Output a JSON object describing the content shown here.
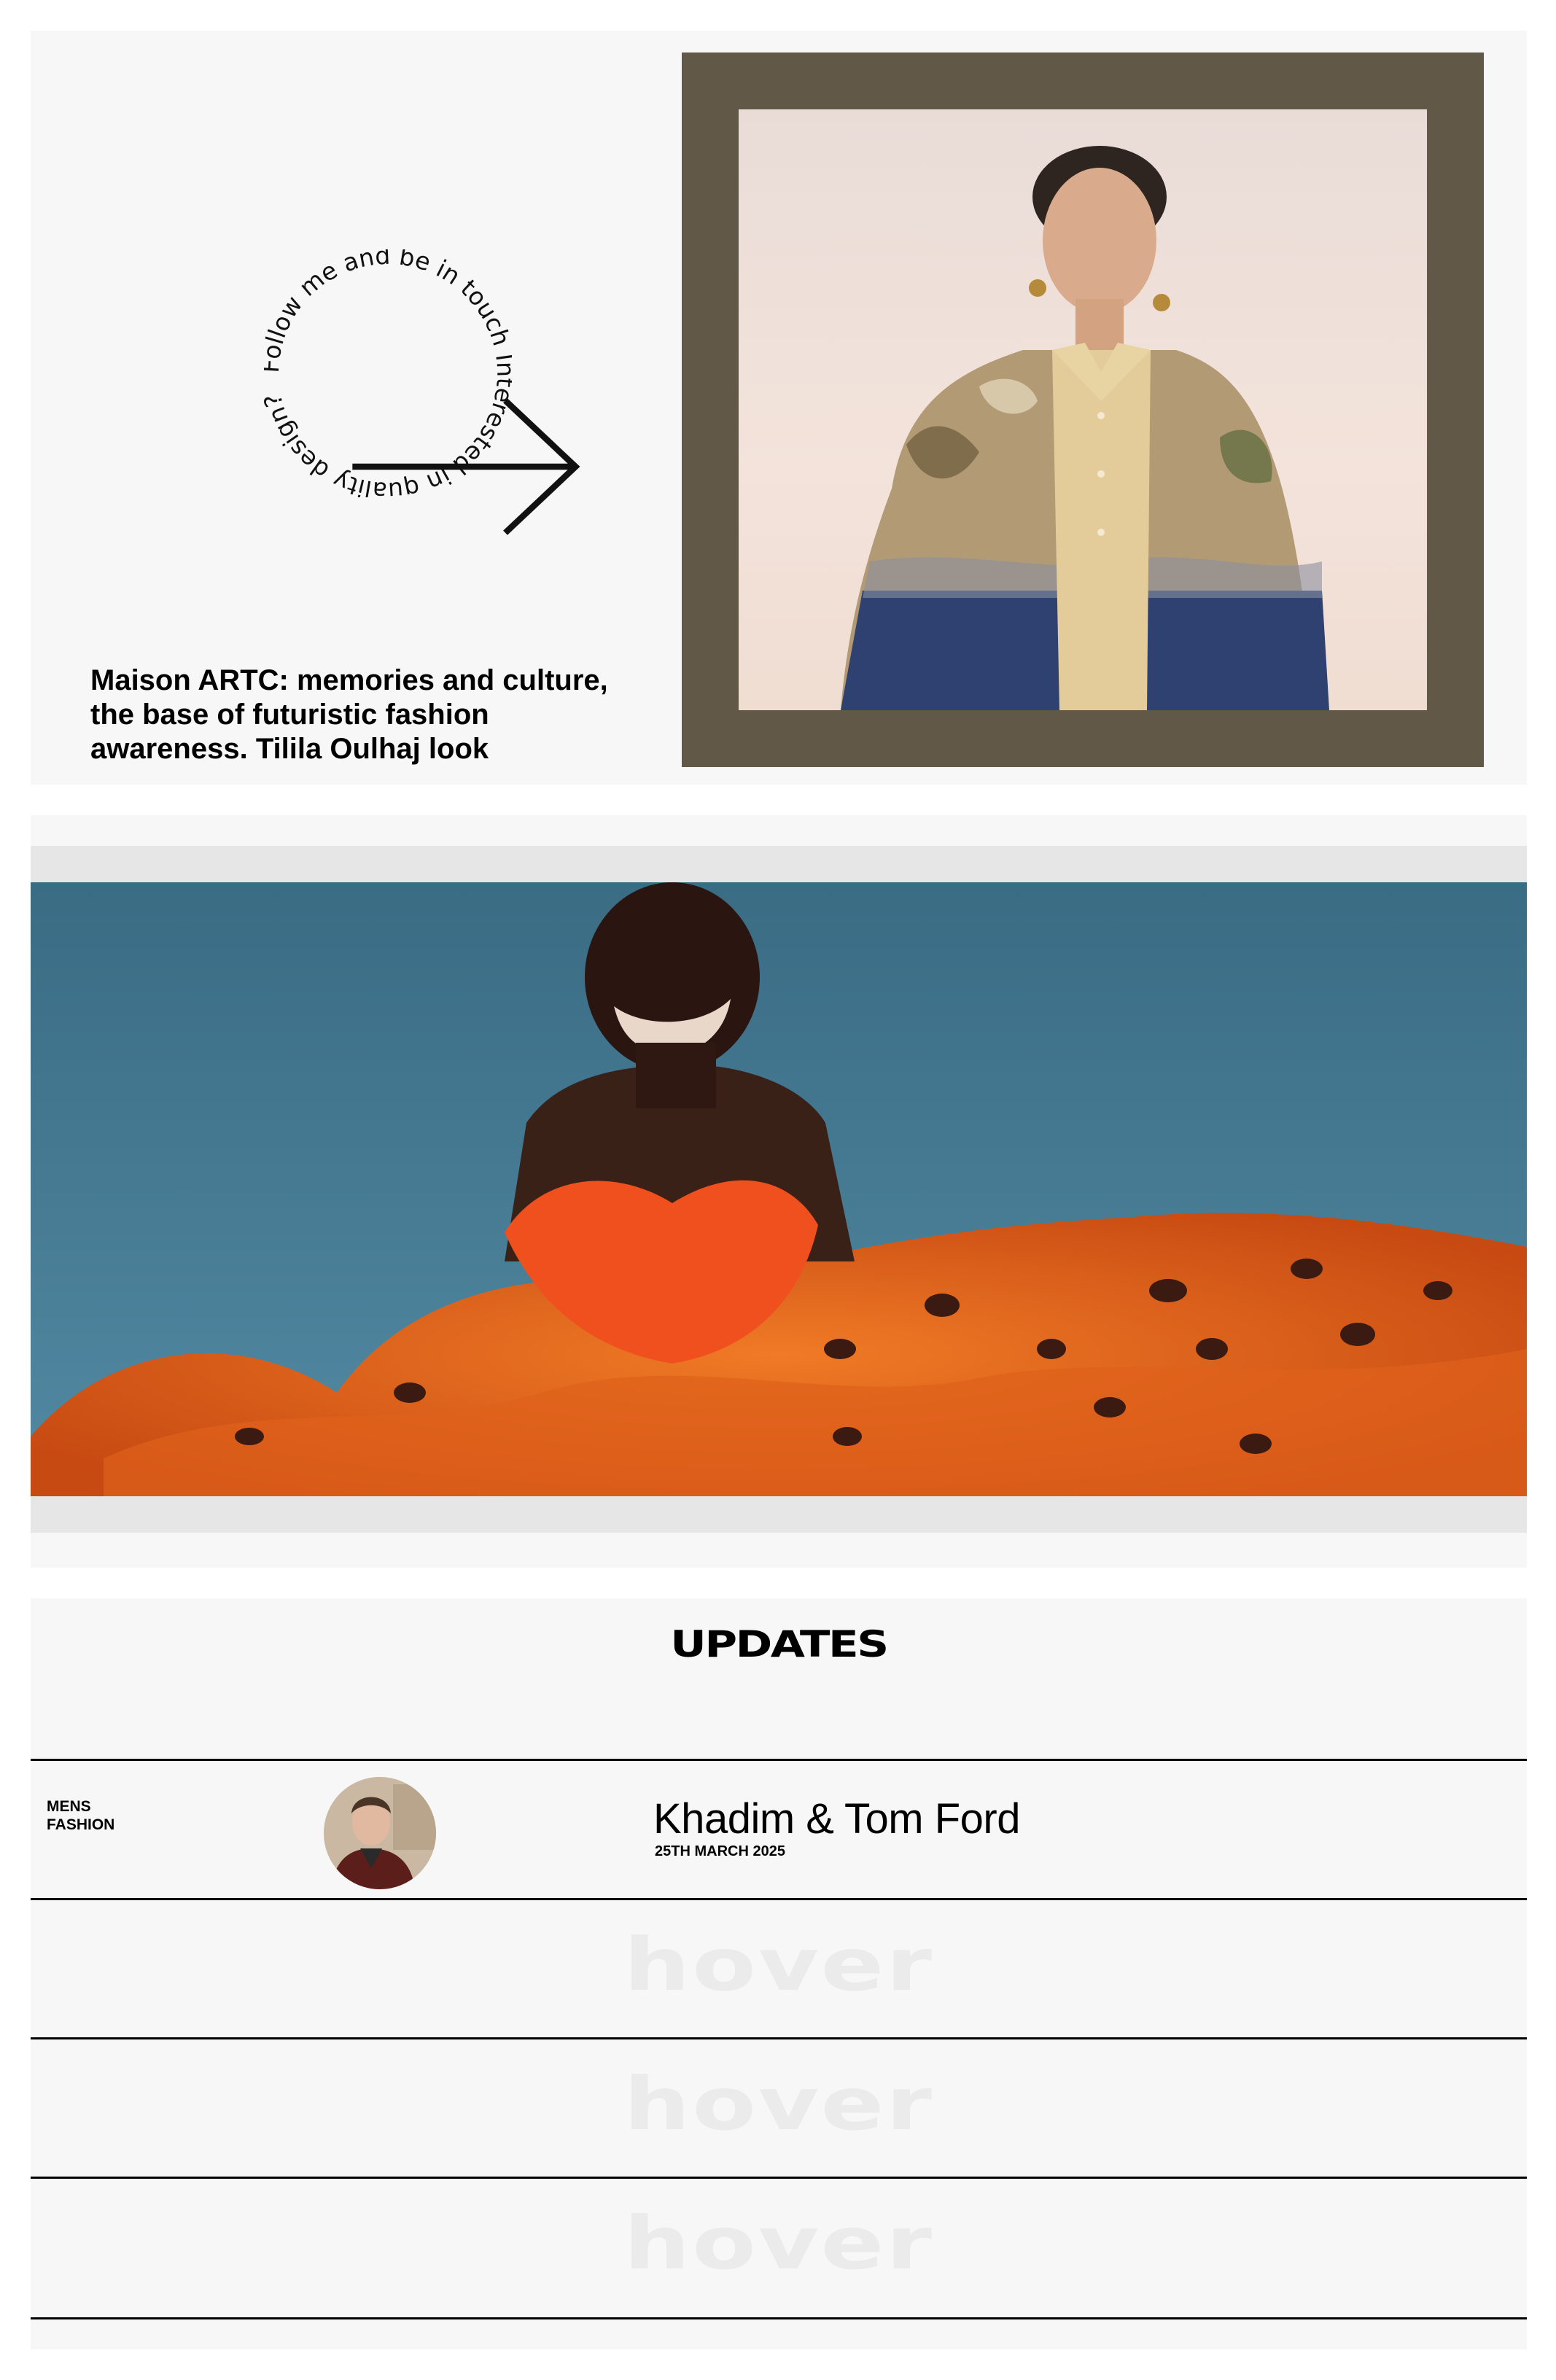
{
  "hero": {
    "circle_text": "Follow me and be in touch Interested in quality design?",
    "arrow_icon": "arrow-right-icon",
    "caption": "Maison ARTC: memories and culture, the base of futuristic fashion awareness. Tilila Oulhaj look",
    "frame_color": "#625847"
  },
  "updates": {
    "title": "UPDATES",
    "rows": [
      {
        "category_line1": "MENS",
        "category_line2": "FASHION",
        "title": "Khadim & Tom Ford",
        "date": "25TH MARCH 2025"
      },
      {
        "hover": "hover"
      },
      {
        "hover": "hover"
      },
      {
        "hover": "hover"
      }
    ]
  }
}
